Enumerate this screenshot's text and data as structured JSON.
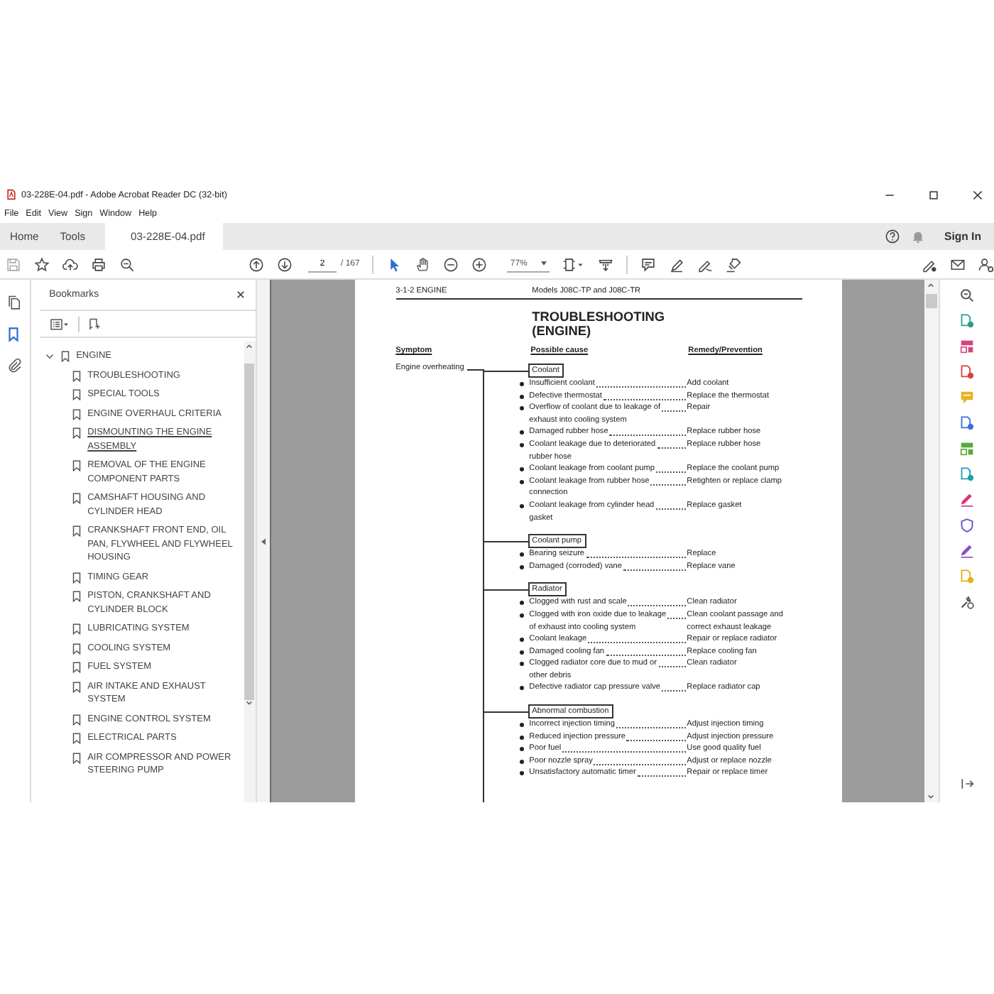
{
  "window": {
    "title": "03-228E-04.pdf - Adobe Acrobat Reader DC (32-bit)"
  },
  "menu": [
    "File",
    "Edit",
    "View",
    "Sign",
    "Window",
    "Help"
  ],
  "tabs": [
    {
      "label": "Home",
      "selected": false
    },
    {
      "label": "Tools",
      "selected": false
    },
    {
      "label": "03-228E-04.pdf",
      "selected": true
    }
  ],
  "sign_in": "Sign In",
  "toolbar": {
    "page": "2",
    "page_count": "/ 167",
    "zoom": "77%"
  },
  "nav": [
    {
      "kind": "pages",
      "selected": false
    },
    {
      "kind": "bookmarks",
      "selected": true
    },
    {
      "kind": "attachments",
      "selected": false
    }
  ],
  "bookmarks": {
    "title": "Bookmarks",
    "items": [
      {
        "label": "ENGINE",
        "expanded": true,
        "children": [
          {
            "label": "TROUBLESHOOTING",
            "selected": false
          },
          {
            "label": "SPECIAL TOOLS",
            "selected": false
          },
          {
            "label": "ENGINE OVERHAUL CRITERIA",
            "selected": false
          },
          {
            "label": "DISMOUNTING THE ENGINE ASSEMBLY",
            "selected": true
          },
          {
            "label": "REMOVAL OF THE ENGINE COMPONENT PARTS",
            "selected": false
          },
          {
            "label": "CAMSHAFT HOUSING AND CYLINDER HEAD",
            "selected": false
          },
          {
            "label": "CRANKSHAFT FRONT END, OIL PAN, FLYWHEEL AND FLYWHEEL HOUSING",
            "selected": false
          },
          {
            "label": "TIMING GEAR",
            "selected": false
          },
          {
            "label": "PISTON, CRANKSHAFT AND CYLINDER BLOCK",
            "selected": false
          },
          {
            "label": "LUBRICATING SYSTEM",
            "selected": false
          },
          {
            "label": "COOLING SYSTEM",
            "selected": false
          },
          {
            "label": "FUEL SYSTEM",
            "selected": false
          },
          {
            "label": "AIR INTAKE AND EXHAUST SYSTEM",
            "selected": false
          },
          {
            "label": "ENGINE CONTROL SYSTEM",
            "selected": false
          },
          {
            "label": "ELECTRICAL PARTS",
            "selected": false
          },
          {
            "label": "AIR COMPRESSOR AND POWER STEERING PUMP",
            "selected": false
          }
        ]
      }
    ]
  },
  "document": {
    "section": "3-1-2 ENGINE",
    "models": "Models J08C-TP and J08C-TR",
    "title": "TROUBLESHOOTING (ENGINE)",
    "columns": [
      "Symptom",
      "Possible cause",
      "Remedy/Prevention"
    ],
    "symptom": "Engine overheating",
    "groups": [
      {
        "label": "Coolant",
        "causes": [
          {
            "cause": "Insufficient coolant",
            "remedy": "Add coolant"
          },
          {
            "cause": "Defective thermostat",
            "remedy": "Replace the thermostat"
          },
          {
            "cause": "Overflow of coolant due to leakage of\nexhaust into cooling system",
            "remedy": "Repair"
          },
          {
            "cause": "Damaged rubber hose",
            "remedy": "Replace rubber hose"
          },
          {
            "cause": "Coolant leakage due to deteriorated\nrubber hose",
            "remedy": "Replace rubber hose"
          },
          {
            "cause": "Coolant leakage from coolant pump",
            "remedy": "Replace the coolant pump"
          },
          {
            "cause": "Coolant leakage from rubber hose\nconnection",
            "remedy": "Retighten or replace clamp"
          },
          {
            "cause": "Coolant leakage from cylinder head\ngasket",
            "remedy": "Replace gasket"
          }
        ]
      },
      {
        "label": "Coolant pump",
        "causes": [
          {
            "cause": "Bearing seizure",
            "remedy": "Replace"
          },
          {
            "cause": "Damaged (corroded) vane",
            "remedy": "Replace vane"
          }
        ]
      },
      {
        "label": "Radiator",
        "causes": [
          {
            "cause": "Clogged with rust and scale",
            "remedy": "Clean radiator"
          },
          {
            "cause": "Clogged with iron oxide due to leakage\nof exhaust into cooling system",
            "remedy": "Clean coolant passage and\ncorrect exhaust leakage"
          },
          {
            "cause": "Coolant leakage",
            "remedy": "Repair or replace radiator"
          },
          {
            "cause": "Damaged cooling fan",
            "remedy": "Replace cooling fan"
          },
          {
            "cause": "Clogged radiator core due to mud or\nother debris",
            "remedy": "Clean radiator"
          },
          {
            "cause": "Defective radiator cap pressure valve",
            "remedy": "Replace radiator cap"
          }
        ]
      },
      {
        "label": "Abnormal combustion",
        "causes": [
          {
            "cause": "Incorrect injection timing",
            "remedy": "Adjust injection timing"
          },
          {
            "cause": "Reduced injection pressure",
            "remedy": "Adjust injection pressure"
          },
          {
            "cause": "Poor fuel",
            "remedy": "Use good quality fuel"
          },
          {
            "cause": "Poor nozzle spray",
            "remedy": "Adjust or replace nozzle"
          },
          {
            "cause": "Unsatisfactory automatic timer",
            "remedy": "Repair or replace timer"
          }
        ]
      }
    ]
  },
  "tools": [
    {
      "kind": "zoom",
      "color": "#555555"
    },
    {
      "kind": "page",
      "color": "#2a9d8f"
    },
    {
      "kind": "layout",
      "color": "#d2477b"
    },
    {
      "kind": "page",
      "color": "#d9423b"
    },
    {
      "kind": "speech",
      "color": "#e6b422"
    },
    {
      "kind": "page",
      "color": "#3e6fd8"
    },
    {
      "kind": "layout",
      "color": "#5aaa3a"
    },
    {
      "kind": "page",
      "color": "#1d9fb0"
    },
    {
      "kind": "pen",
      "color": "#d6357f"
    },
    {
      "kind": "shield",
      "color": "#6f56d1"
    },
    {
      "kind": "pen",
      "color": "#8a4fd1"
    },
    {
      "kind": "page",
      "color": "#e0b21c"
    },
    {
      "kind": "wrench",
      "color": "#555555"
    }
  ]
}
